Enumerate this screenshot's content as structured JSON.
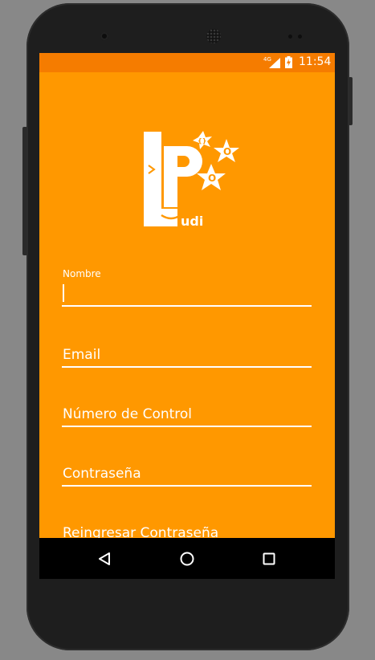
{
  "status_bar": {
    "network": "4G",
    "time": "11:54"
  },
  "logo": {
    "icon": "lpoo-ludi-logo",
    "text": "LPOO Ludi"
  },
  "form": {
    "name_label": "Nombre",
    "name_value": "",
    "email_placeholder": "Email",
    "control_placeholder": "Número de Control",
    "password_placeholder": "Contraseña",
    "confirm_placeholder": "Reingresar Contraseña"
  },
  "nav": {
    "back_icon": "back-triangle-icon",
    "home_icon": "home-circle-icon",
    "recents_icon": "recents-square-icon"
  },
  "colors": {
    "app_background": "#ff9800",
    "status_bar": "#f57c00",
    "navigation_bar": "#000000"
  }
}
